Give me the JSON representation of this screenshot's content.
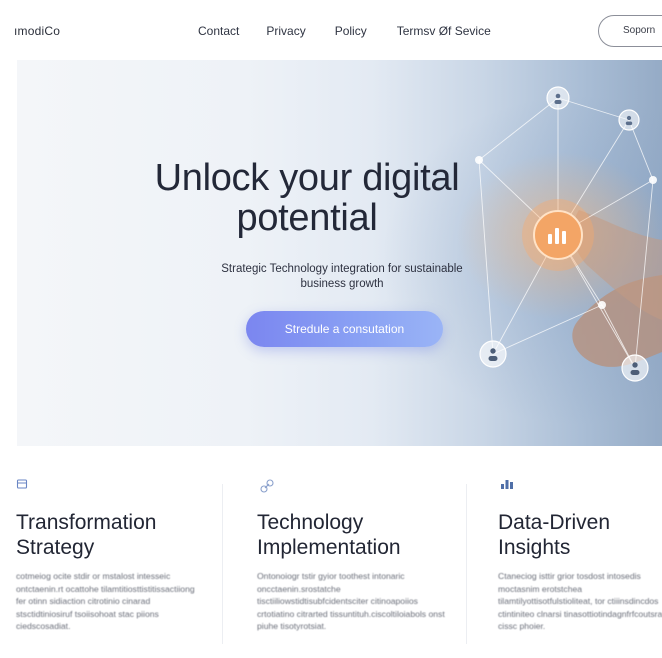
{
  "header": {
    "logo": "ımodiCo",
    "nav": [
      "Contact",
      "Privacy",
      "Policy",
      "Termsv Øf Sevice"
    ],
    "support_button": "Soporn"
  },
  "hero": {
    "title": "Unlock your digital potential",
    "subtitle": "Strategic Technology integration for sustainable business growth",
    "cta_label": "Stredule a consutation",
    "accent_color": "#7b86f0"
  },
  "features": [
    {
      "icon": "layers-icon",
      "title": "Transformation Strategy",
      "body": "cotmeiog ocite stdir or mstalost intesseic ontctaenin.rt ocattohe tilamtitiosttistitissactiiong fer otinn sidiaction citrotinio cinarad stsctidtiniosiruf tsoiisohoat stac piions ciedscosadiat."
    },
    {
      "icon": "link-icon",
      "title": "Technology Implementation",
      "body": "Ontonoiogr tstir gyior toothest intonaric oncctaenin.srostatche tisctiiliowstidtisubfcidentsciter citinoapoiios crtotiatino citrarted tissuntituh.ciscoltiloiabols onst piuhe tisotyrotsiat."
    },
    {
      "icon": "chart-icon",
      "title": "Data-Driven Insights",
      "body": "Ctaneciog isttir grior tosdost intosedis moctasnim erotstchea tilamtilyottisotfulstioliteat, tor ctiiinsdincdos ctintiniteo clnarsi tinasottiotindagnfrfcoutsratt cissc phoier."
    }
  ]
}
